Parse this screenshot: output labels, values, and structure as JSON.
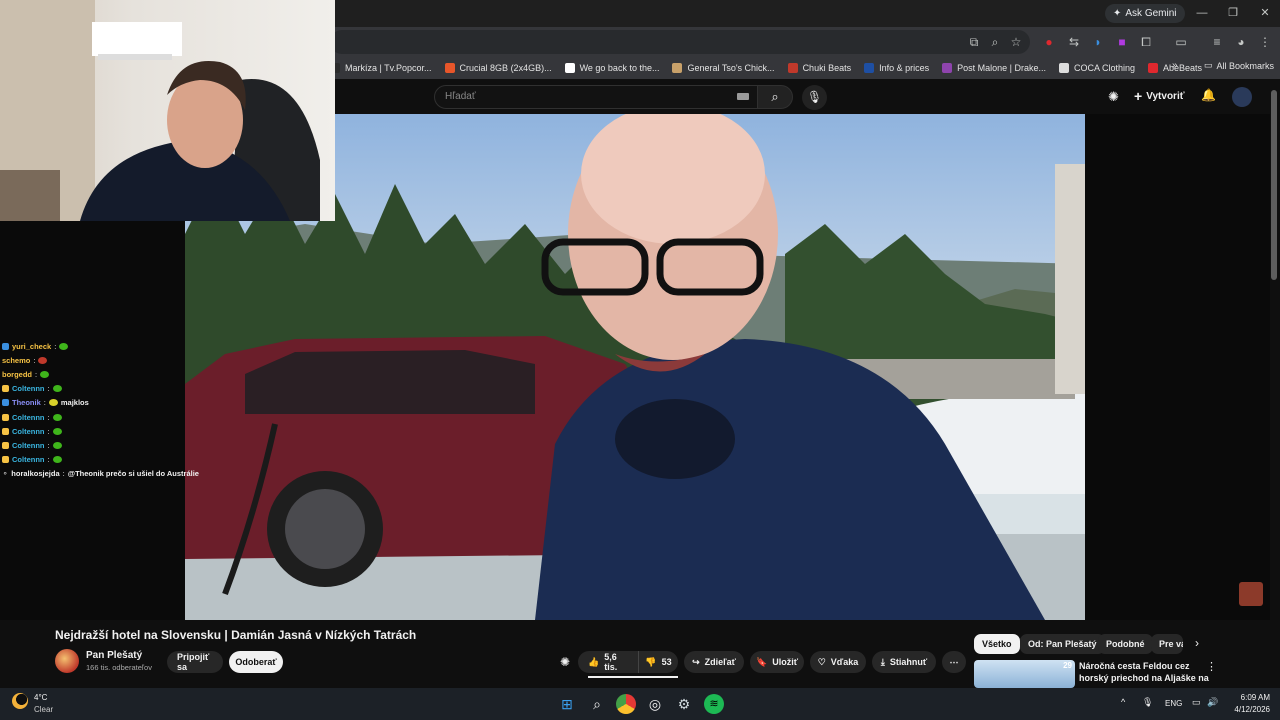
{
  "browser": {
    "ask_gemini": "Ask Gemini",
    "bookmarks": [
      {
        "label": "Markíza | Tv.Popcor...",
        "color": "#2b2b2b"
      },
      {
        "label": "Crucial 8GB (2x4GB)...",
        "color": "#e8562a"
      },
      {
        "label": "We go back to the...",
        "color": "#ffffff"
      },
      {
        "label": "General Tso's Chick...",
        "color": "#c8a16a"
      },
      {
        "label": "Chuki Beats",
        "color": "#c0392b"
      },
      {
        "label": "Info & prices",
        "color": "#1e4fa3"
      },
      {
        "label": "Post Malone | Drake...",
        "color": "#8e44ad"
      },
      {
        "label": "COCA Clothing",
        "color": "#dddddd"
      },
      {
        "label": "AbeBeats",
        "color": "#e0282e"
      }
    ],
    "all_bookmarks": "All Bookmarks"
  },
  "youtube": {
    "search_placeholder": "Hľadať",
    "create_label": "Vytvoriť"
  },
  "chat": [
    {
      "user": "yuri_check",
      "msg": "",
      "badge": "#3a8fe0",
      "emote": true
    },
    {
      "user": "schemo",
      "msg": "",
      "badge": "",
      "emote": true
    },
    {
      "user": "borgedd",
      "msg": "",
      "badge": "",
      "emote": true
    },
    {
      "user": "Coltennn",
      "msg": "",
      "badge": "#f6c244",
      "emote": true
    },
    {
      "user": "Theonik",
      "msg": "majklos",
      "badge": "#3a8fe0",
      "emote": true
    },
    {
      "user": "Coltennn",
      "msg": "",
      "badge": "#f6c244",
      "emote": true
    },
    {
      "user": "Coltennn",
      "msg": "",
      "badge": "#f6c244",
      "emote": true
    },
    {
      "user": "Coltennn",
      "msg": "",
      "badge": "#f6c244",
      "emote": true
    },
    {
      "user": "Coltennn",
      "msg": "",
      "badge": "#f6c244",
      "emote": true
    },
    {
      "user": "horalkosjejda",
      "msg": "@Theonik prečo si ušiel do Austrálie",
      "badge": "",
      "emote": false
    }
  ],
  "video": {
    "title": "Nejdražší hotel na Slovensku | Damián Jasná v Nízkých Tatrách",
    "channel": "Pan Plešatý",
    "subscribers": "166 tis. odberateľov",
    "join": "Pripojiť sa",
    "subscribe": "Odoberať",
    "likes": "5,6 tis.",
    "dislikes": "53",
    "share": "Zdieľať",
    "save": "Uložiť",
    "thanks": "Vďaka",
    "download": "Stiahnuť"
  },
  "sidebar": {
    "chips": [
      "Všetko",
      "Od: Pan Plešatý",
      "Podobné",
      "Pre vás"
    ],
    "rec_title": "Náročná cesta Feldou cez horský priechod na Aljaške na ...",
    "rec_badge": "29"
  },
  "taskbar": {
    "temp": "4°C",
    "weather": "Clear",
    "lang": "ENG",
    "time": "6:09 AM",
    "date": "4/12/2026"
  }
}
